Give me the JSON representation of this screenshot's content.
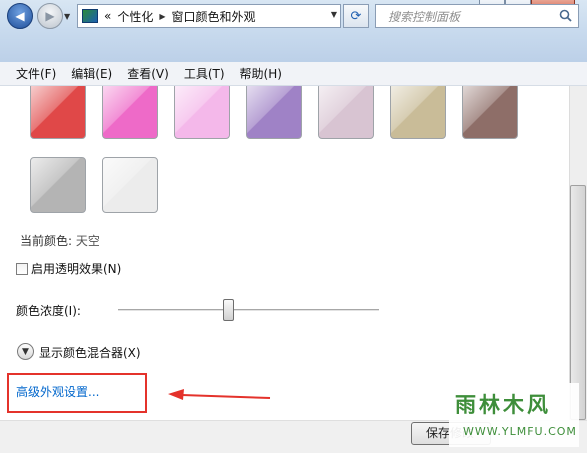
{
  "window": {
    "minimize_icon": "minimize-icon",
    "maximize_icon": "maximize-icon",
    "close_icon": "close-icon"
  },
  "navigation": {
    "breadcrumb_prefix": "«",
    "breadcrumb": [
      "个性化",
      "窗口颜色和外观"
    ],
    "search_placeholder": "搜索控制面板"
  },
  "menu": [
    "文件(F)",
    "编辑(E)",
    "查看(V)",
    "工具(T)",
    "帮助(H)"
  ],
  "swatches": {
    "row1": [
      {
        "color": "#e04848"
      },
      {
        "color": "#ee6ac8"
      },
      {
        "color": "#f4b8ea"
      },
      {
        "color": "#9f82c6"
      },
      {
        "color": "#d8c4d2"
      },
      {
        "color": "#c9bc98"
      },
      {
        "color": "#8e6e68"
      }
    ],
    "row2": [
      {
        "color": "#b4b4b4"
      },
      {
        "color": "#ececec"
      }
    ]
  },
  "current_color": {
    "label": "当前颜色:",
    "value": "天空"
  },
  "transparency": {
    "label": "启用透明效果(N)",
    "checked": false
  },
  "intensity": {
    "label": "颜色浓度(I):",
    "level": 0.42
  },
  "mixer": {
    "label": "显示颜色混合器(X)"
  },
  "advanced_link": "高级外观设置...",
  "buttons": {
    "save": "保存修改"
  },
  "watermark": {
    "main": "雨林木风",
    "sub": "WWW.YLMFU.COM"
  },
  "colors": {
    "link": "#0066cc",
    "annotation": "#e4322b"
  }
}
